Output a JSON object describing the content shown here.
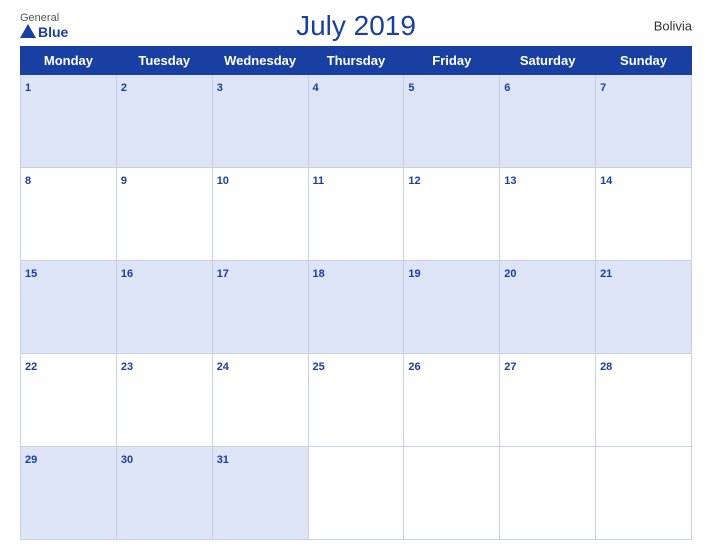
{
  "header": {
    "logo_general": "General",
    "logo_blue": "Blue",
    "title": "July 2019",
    "country": "Bolivia"
  },
  "days_of_week": [
    "Monday",
    "Tuesday",
    "Wednesday",
    "Thursday",
    "Friday",
    "Saturday",
    "Sunday"
  ],
  "weeks": [
    [
      1,
      2,
      3,
      4,
      5,
      6,
      7
    ],
    [
      8,
      9,
      10,
      11,
      12,
      13,
      14
    ],
    [
      15,
      16,
      17,
      18,
      19,
      20,
      21
    ],
    [
      22,
      23,
      24,
      25,
      26,
      27,
      28
    ],
    [
      29,
      30,
      31,
      null,
      null,
      null,
      null
    ]
  ]
}
